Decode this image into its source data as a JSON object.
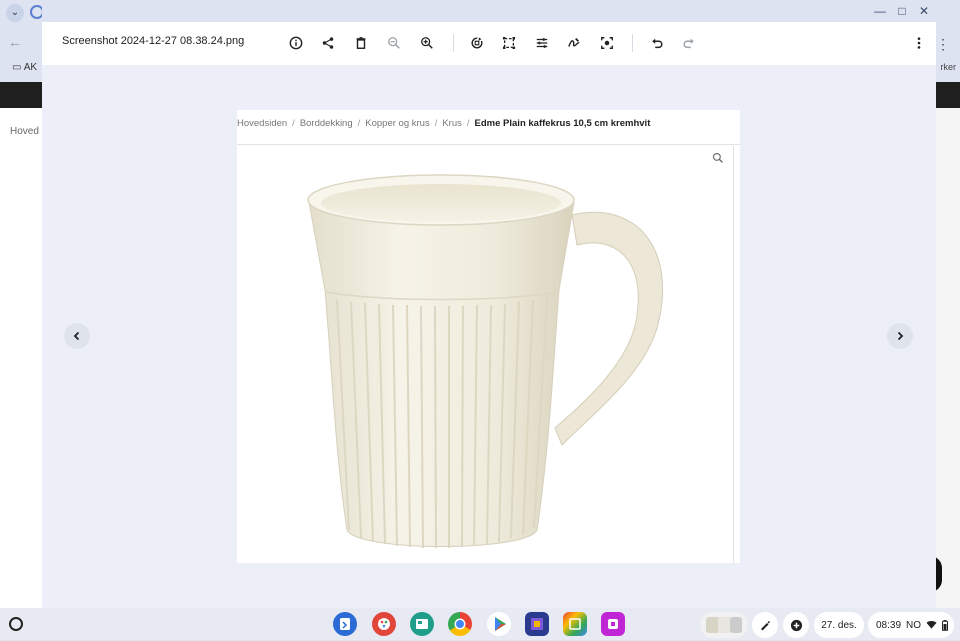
{
  "browser": {
    "bookmark_label": "AK",
    "bookmark_right": "rker",
    "page_crumb": "Hoved"
  },
  "viewer": {
    "filename": "Screenshot 2024-12-27 08.38.24.png",
    "toolbar_icons": [
      "info-icon",
      "share-icon",
      "delete-icon",
      "zoom-out-icon",
      "zoom-in-icon",
      "rotate-icon",
      "crop-icon",
      "adjust-icon",
      "annotate-icon",
      "lens-icon",
      "undo-icon",
      "redo-icon",
      "more-icon"
    ]
  },
  "image": {
    "breadcrumbs": [
      "Hovedsiden",
      "Borddekking",
      "Kopper og krus",
      "Krus"
    ],
    "current": "Edme Plain kaffekrus 10,5 cm kremhvit"
  },
  "shelf": {
    "date": "27. des.",
    "time": "08:39",
    "locale": "NO"
  }
}
